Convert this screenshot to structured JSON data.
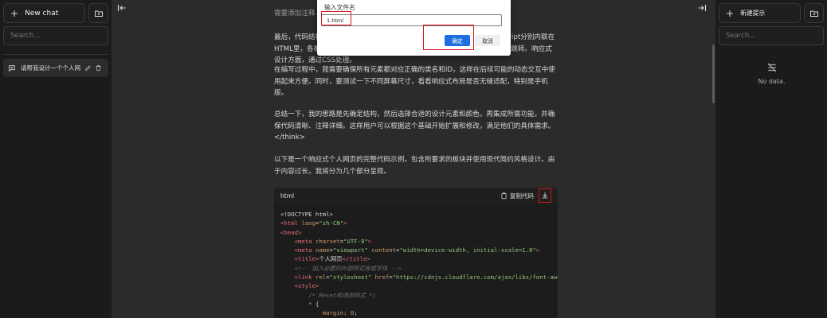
{
  "left_sidebar": {
    "new_chat_label": "New chat",
    "search_placeholder": "Search...",
    "chats": [
      {
        "label": "请帮我设计一个个人网..."
      }
    ]
  },
  "main": {
    "paragraphs": [
      "需要添加注释...",
      "最后，代码结构要清晰，方便用户后续修改和扩展。可能需要将CSS和JavaScript分别内联在HTML里，各板块用<section>标签划分，每个section有对应的id，方便导航跳转。响应式设计方面，通过CSS处理。",
      "在编写过程中，我需要确保所有元素都对应正确的类名和ID，这样在后续可能的动态交互中使用起来方便。同时，要测试一下不同屏幕尺寸，看看响应式布局是否无缝适配，特别是手机版。",
      "总结一下，我的思路是先确定结构，然后选择合适的设计元素和颜色，再集成所需功能，并确保代码清晰、注释详细。这样用户可以根据这个基础开始扩展和修改，满足他们的具体需求。</think>",
      "以下是一个响应式个人网页的完整代码示例，包含所要求的板块并使用现代简约风格设计。由于内容过长，我将分为几个部分呈现。"
    ],
    "code_block": {
      "language": "html",
      "copy_label": "复制代码"
    }
  },
  "dialog": {
    "title": "输入文件名",
    "input_value": "1.html",
    "ok_label": "确定",
    "cancel_label": "取消"
  },
  "right_sidebar": {
    "new_prompt_label": "新建提示",
    "search_placeholder": "Search...",
    "empty_text": "No data."
  },
  "colors": {
    "accent": "#1f6fe0",
    "highlight": "#d9141b",
    "background": "#2b2b2b",
    "sidebar": "#1b1b1b"
  }
}
